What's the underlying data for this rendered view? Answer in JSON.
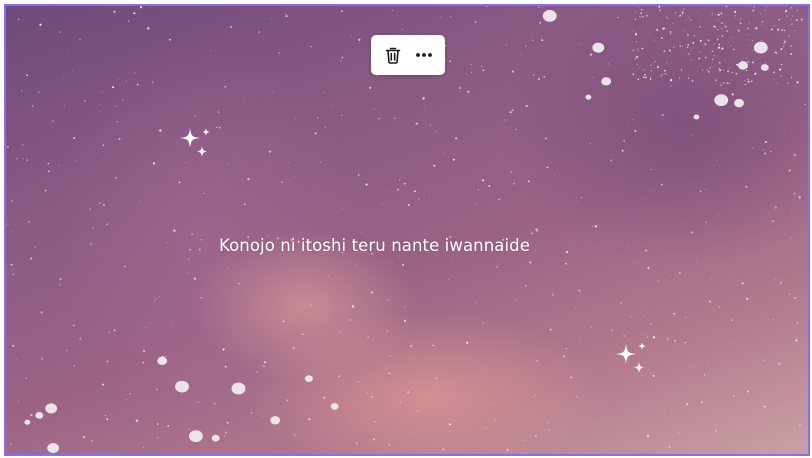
{
  "toolbar": {
    "delete_icon": "trash-icon",
    "more_icon": "more-horizontal-icon"
  },
  "canvas": {
    "caption": "Konojo ni itoshi teru nante iwannaide",
    "selection_color": "#8b6cf0",
    "sparkle_icon": "sparkle-icon"
  }
}
